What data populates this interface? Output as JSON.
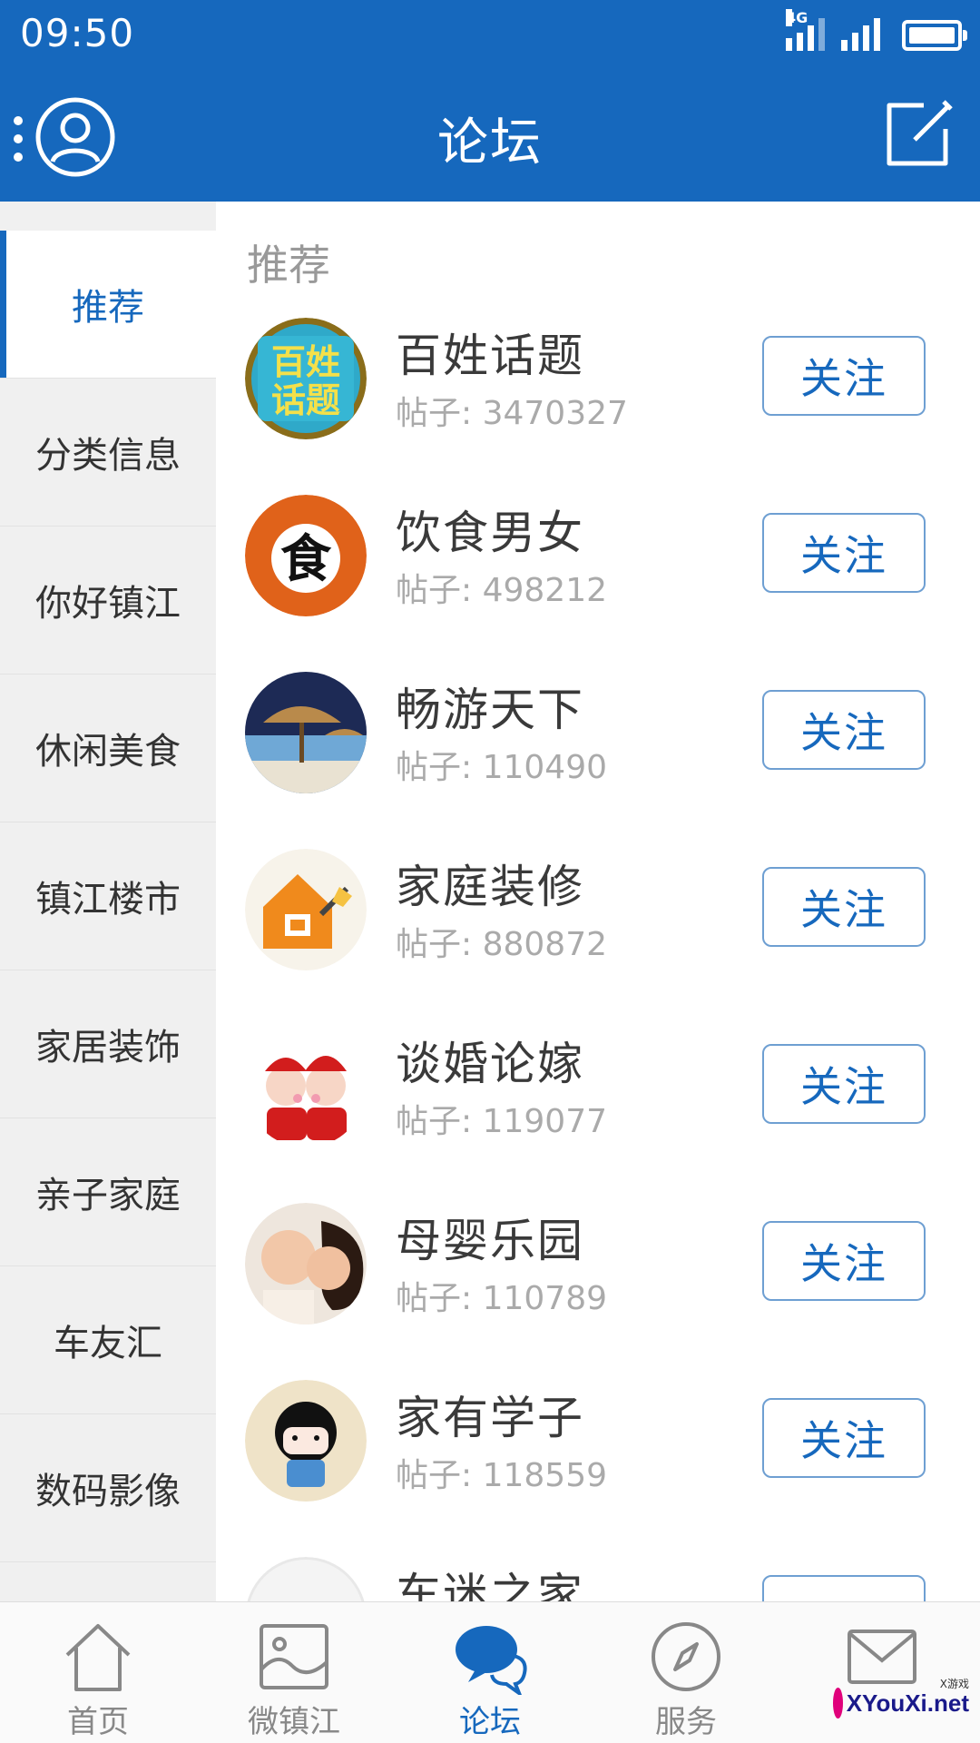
{
  "status_bar": {
    "time": "09:50",
    "network_label": "4G"
  },
  "header": {
    "title": "论坛"
  },
  "left_nav": {
    "items": [
      {
        "label": "推荐",
        "active": true
      },
      {
        "label": "分类信息"
      },
      {
        "label": "你好镇江"
      },
      {
        "label": "休闲美食"
      },
      {
        "label": "镇江楼市"
      },
      {
        "label": "家居装饰"
      },
      {
        "label": "亲子家庭"
      },
      {
        "label": "车友汇"
      },
      {
        "label": "数码影像"
      }
    ]
  },
  "content": {
    "section_title": "推荐",
    "forums": [
      {
        "name": "百姓话题",
        "posts": "帖子: 3470327",
        "follow": "关注",
        "avatar_text": "百姓话题"
      },
      {
        "name": "饮食男女",
        "posts": "帖子: 498212",
        "follow": "关注",
        "avatar_text": "食"
      },
      {
        "name": "畅游天下",
        "posts": "帖子: 110490",
        "follow": "关注"
      },
      {
        "name": "家庭装修",
        "posts": "帖子: 880872",
        "follow": "关注"
      },
      {
        "name": "谈婚论嫁",
        "posts": "帖子: 119077",
        "follow": "关注"
      },
      {
        "name": "母婴乐园",
        "posts": "帖子: 110789",
        "follow": "关注"
      },
      {
        "name": "家有学子",
        "posts": "帖子: 118559",
        "follow": "关注"
      },
      {
        "name": "车迷之家",
        "posts": "",
        "follow": ""
      }
    ]
  },
  "tab_bar": {
    "tabs": [
      {
        "label": "首页",
        "icon": "home-icon"
      },
      {
        "label": "微镇江",
        "icon": "image-icon"
      },
      {
        "label": "论坛",
        "icon": "chat-bubble-icon",
        "active": true
      },
      {
        "label": "服务",
        "icon": "compass-icon"
      },
      {
        "label": "",
        "icon": "mail-icon"
      }
    ]
  },
  "watermark": {
    "text": "XYouXi.net",
    "small": "X游戏"
  },
  "colors": {
    "primary": "#1668bd",
    "nav_bg": "#f0f0f0",
    "muted_text": "#aaaaaa"
  }
}
